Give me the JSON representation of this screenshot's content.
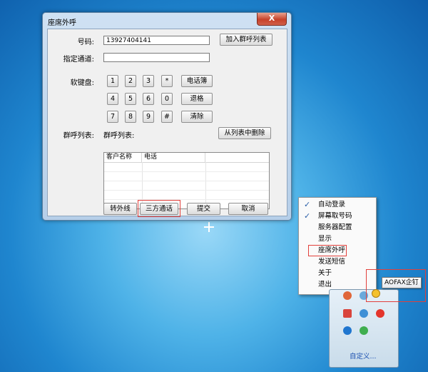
{
  "window": {
    "title": "座席外呼",
    "close_label": "X"
  },
  "form": {
    "number_label": "号码:",
    "number_value": "13927404141",
    "channel_label": "指定通道:",
    "channel_value": "",
    "keypad_label": "软键盘:",
    "group_label": "群呼列表:",
    "group_list_caption": "群呼列表:"
  },
  "buttons": {
    "add_to_group": "加入群呼列表",
    "phonebook": "电话簿",
    "backspace": "退格",
    "clear": "清除",
    "remove_from_list": "从列表中删除",
    "transfer_external": "转外线",
    "three_way_call": "三方通话",
    "submit": "提交",
    "cancel": "取消"
  },
  "keypad": {
    "row1": [
      "1",
      "2",
      "3",
      "*"
    ],
    "row2": [
      "4",
      "5",
      "6",
      "0"
    ],
    "row3": [
      "7",
      "8",
      "9",
      "#"
    ]
  },
  "table": {
    "columns": [
      "客户名称",
      "电话"
    ]
  },
  "context_menu": {
    "items": [
      {
        "label": "自动登录",
        "checked": true
      },
      {
        "label": "屏幕取号码",
        "checked": true
      },
      {
        "label": "服务器配置",
        "checked": false
      },
      {
        "label": "显示",
        "checked": false
      },
      {
        "label": "座席外呼",
        "checked": false,
        "highlighted": true
      },
      {
        "label": "发送短信",
        "checked": false
      },
      {
        "label": "关于",
        "checked": false
      },
      {
        "label": "退出",
        "checked": false
      }
    ]
  },
  "tray": {
    "tooltip": "AOFAX企钉",
    "customize_link": "自定义...",
    "icons": [
      "tray-app-icon",
      "tray-app-icon",
      "qq-icon",
      "tray-app-icon",
      "tray-app-icon",
      "weibo-icon",
      "tray-app-icon",
      "tray-app-icon"
    ]
  },
  "colors": {
    "highlight": "#e2403b",
    "close_button": "#c7422a",
    "link": "#1a4fb0"
  }
}
